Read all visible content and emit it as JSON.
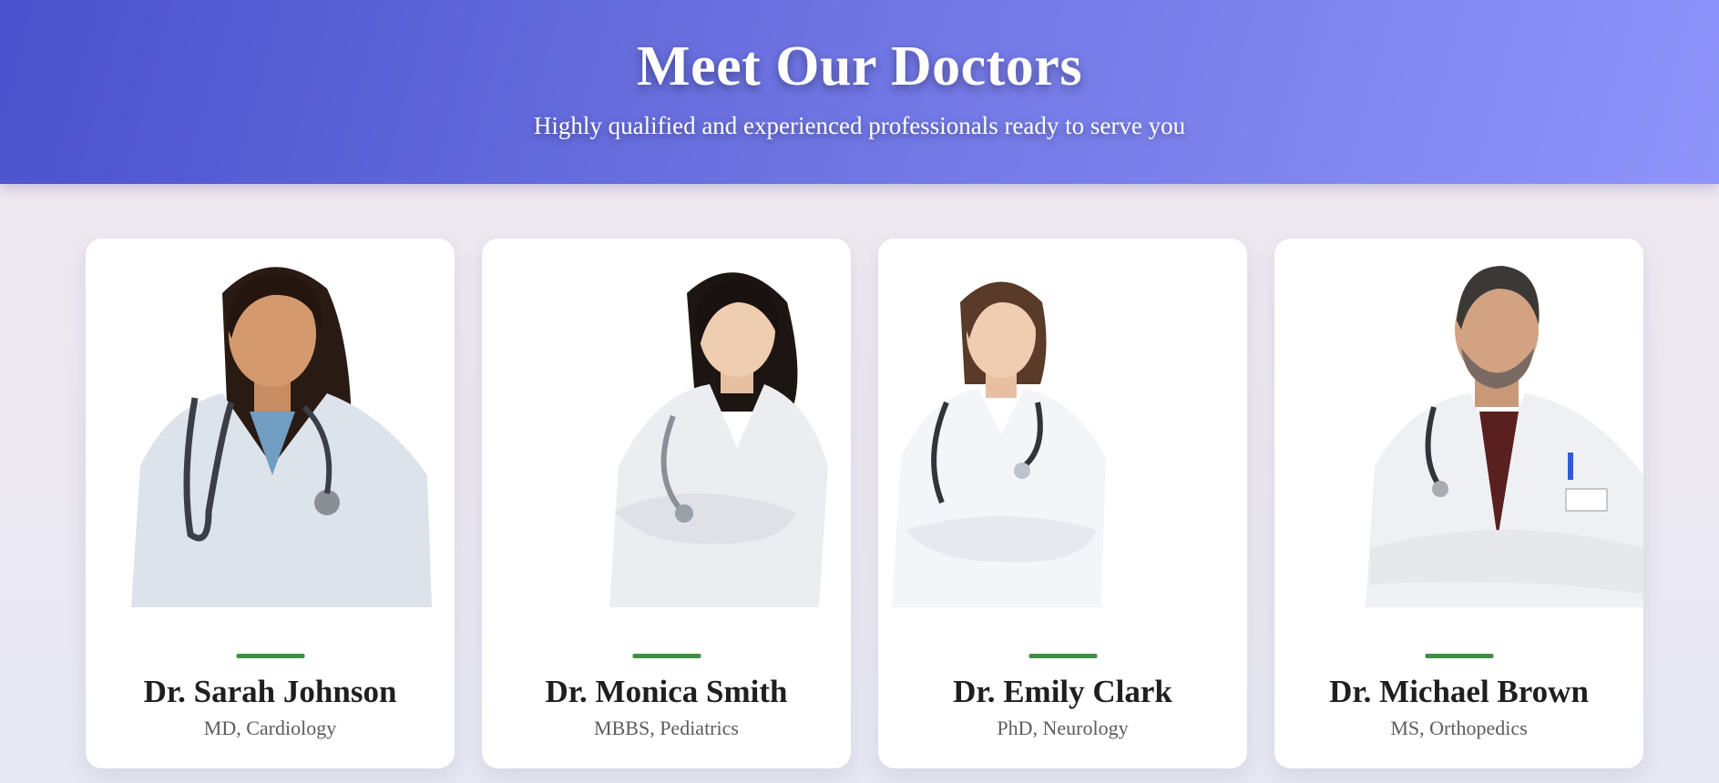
{
  "header": {
    "title": "Meet Our Doctors",
    "subtitle": "Highly qualified and experienced professionals ready to serve you"
  },
  "colors": {
    "header_gradient_start": "#4a52cd",
    "header_gradient_end": "#8f94fb",
    "accent_bar": "#3f8f44",
    "card_bg": "#ffffff"
  },
  "doctors": [
    {
      "name": "Dr. Sarah Johnson",
      "specialty": "MD, Cardiology",
      "photo": "doctor-photo-female"
    },
    {
      "name": "Dr. Monica Smith",
      "specialty": "MBBS, Pediatrics",
      "photo": "doctor-photo-female"
    },
    {
      "name": "Dr. Emily Clark",
      "specialty": "PhD, Neurology",
      "photo": "doctor-photo-female"
    },
    {
      "name": "Dr. Michael Brown",
      "specialty": "MS, Orthopedics",
      "photo": "doctor-photo-male"
    }
  ]
}
